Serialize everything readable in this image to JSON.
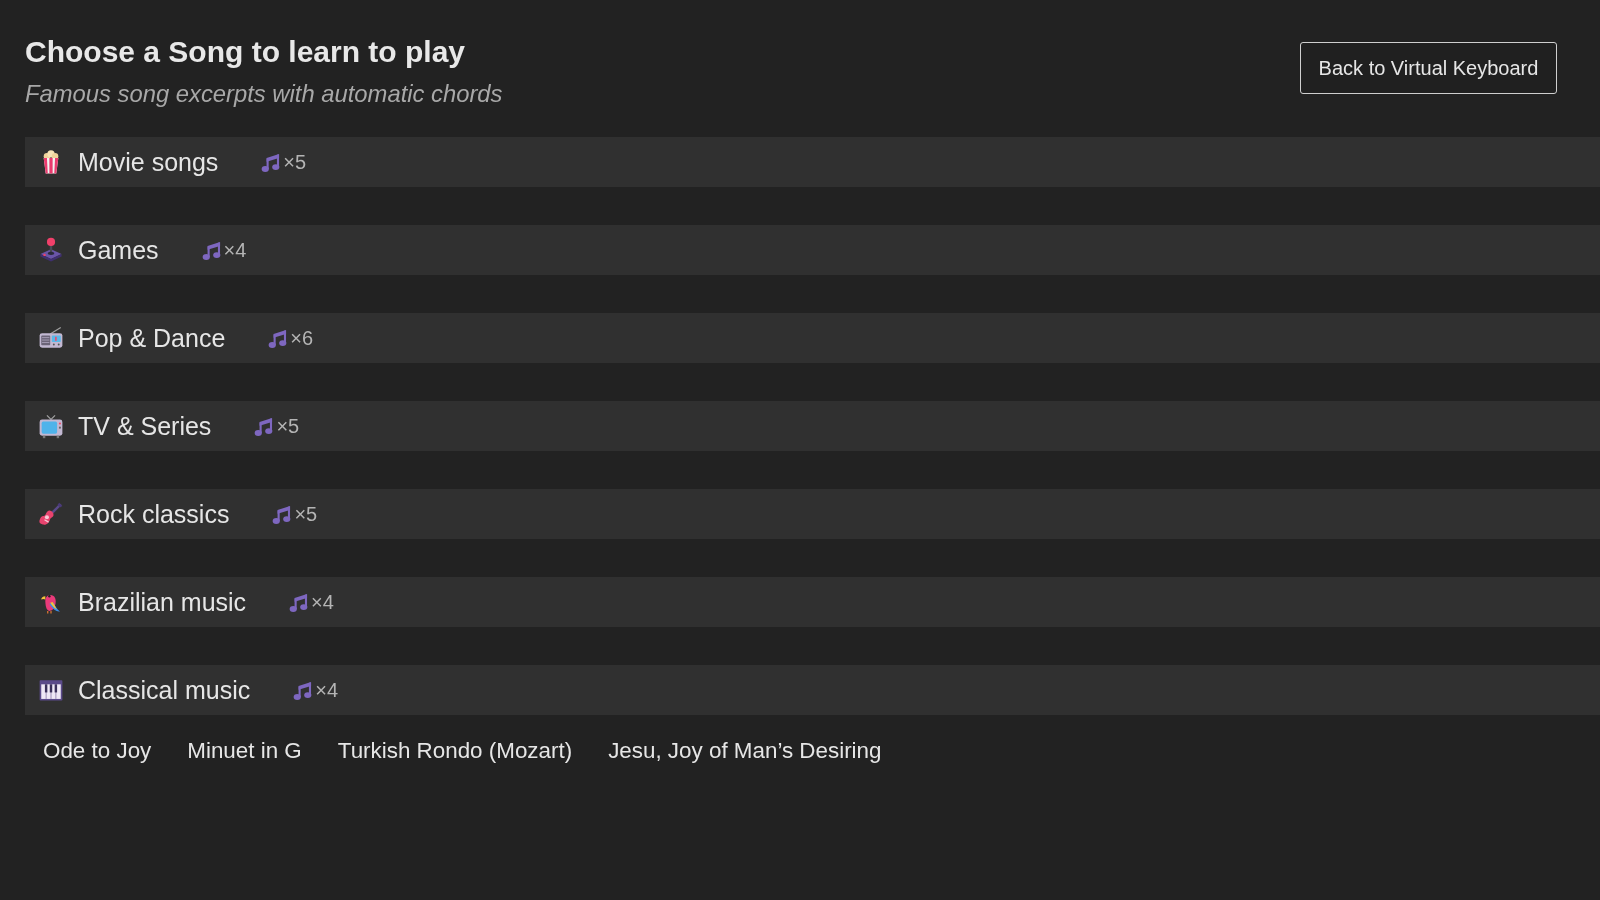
{
  "header": {
    "title": "Choose a Song to learn to play",
    "subtitle": "Famous song excerpts with automatic chords"
  },
  "back_button": {
    "label": "Back to Virtual Keyboard"
  },
  "categories": [
    {
      "name": "Movie songs",
      "count": "×5"
    },
    {
      "name": "Games",
      "count": "×4"
    },
    {
      "name": "Pop & Dance",
      "count": "×6"
    },
    {
      "name": "TV & Series",
      "count": "×5"
    },
    {
      "name": "Rock classics",
      "count": "×5"
    },
    {
      "name": "Brazilian music",
      "count": "×4"
    },
    {
      "name": "Classical music",
      "count": "×4",
      "songs": [
        "Ode to Joy",
        "Minuet in G",
        "Turkish Rondo (Mozart)",
        "Jesu, Joy of Man’s Desiring"
      ]
    }
  ]
}
